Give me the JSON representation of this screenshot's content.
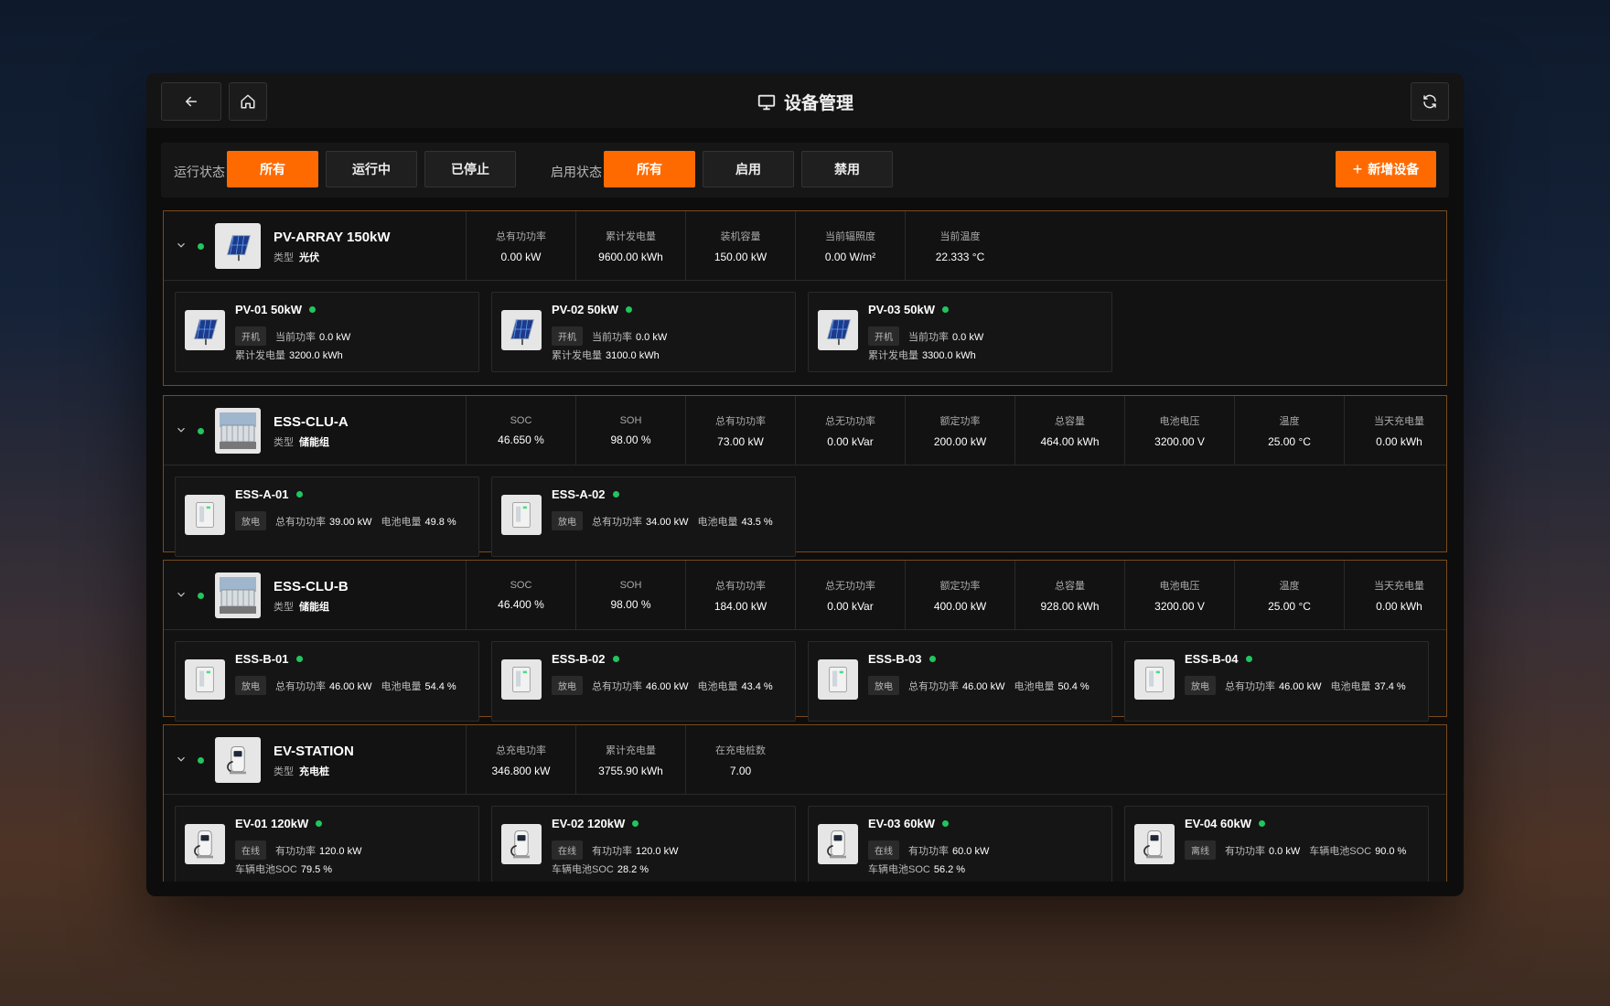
{
  "header": {
    "title": "设备管理"
  },
  "icons": {
    "back": "arrow-left-icon",
    "home": "home-icon",
    "title": "monitor-icon",
    "refresh": "refresh-icon",
    "add": "plus-icon",
    "expand": "chevron-down-icon"
  },
  "colors": {
    "accent": "#ff6a00",
    "online": "#22c55e",
    "group_border": "#7a4a1c"
  },
  "filters": {
    "run_label": "运行状态",
    "run_options": [
      "所有",
      "运行中",
      "已停止"
    ],
    "run_selected": "所有",
    "enable_label": "启用状态",
    "enable_options": [
      "所有",
      "启用",
      "禁用"
    ],
    "enable_selected": "所有",
    "add_label": "新增设备"
  },
  "groups": [
    {
      "name": "PV-ARRAY 150kW",
      "type_label": "类型",
      "type": "光伏",
      "thumb": "solar-panel",
      "metrics": [
        {
          "label": "总有功功率",
          "value": "0.00 kW"
        },
        {
          "label": "累计发电量",
          "value": "9600.00 kWh"
        },
        {
          "label": "装机容量",
          "value": "150.00 kW"
        },
        {
          "label": "当前辐照度",
          "value": "0.00 W/m²"
        },
        {
          "label": "当前温度",
          "value": "22.333 °C"
        }
      ],
      "devices": [
        {
          "name": "PV-01 50kW",
          "tag": "开机",
          "l1_label": "当前功率",
          "l1_value": "0.0 kW",
          "l2_label": "累计发电量",
          "l2_value": "3200.0 kWh"
        },
        {
          "name": "PV-02 50kW",
          "tag": "开机",
          "l1_label": "当前功率",
          "l1_value": "0.0 kW",
          "l2_label": "累计发电量",
          "l2_value": "3100.0 kWh"
        },
        {
          "name": "PV-03 50kW",
          "tag": "开机",
          "l1_label": "当前功率",
          "l1_value": "0.0 kW",
          "l2_label": "累计发电量",
          "l2_value": "3300.0 kWh"
        }
      ]
    },
    {
      "name": "ESS-CLU-A",
      "type_label": "类型",
      "type": "储能组",
      "thumb": "storage-cluster",
      "metrics": [
        {
          "label": "SOC",
          "value": "46.650 %"
        },
        {
          "label": "SOH",
          "value": "98.00 %"
        },
        {
          "label": "总有功功率",
          "value": "73.00 kW"
        },
        {
          "label": "总无功功率",
          "value": "0.00 kVar"
        },
        {
          "label": "额定功率",
          "value": "200.00 kW"
        },
        {
          "label": "总容量",
          "value": "464.00 kWh"
        },
        {
          "label": "电池电压",
          "value": "3200.00 V"
        },
        {
          "label": "温度",
          "value": "25.00 °C"
        },
        {
          "label": "当天充电量",
          "value": "0.00 kWh"
        }
      ],
      "devices": [
        {
          "name": "ESS-A-01",
          "tag": "放电",
          "l1_label": "总有功功率",
          "l1_value": "39.00 kW",
          "l1b_label": "电池电量",
          "l1b_value": "49.8 %"
        },
        {
          "name": "ESS-A-02",
          "tag": "放电",
          "l1_label": "总有功功率",
          "l1_value": "34.00 kW",
          "l1b_label": "电池电量",
          "l1b_value": "43.5 %"
        }
      ]
    },
    {
      "name": "ESS-CLU-B",
      "type_label": "类型",
      "type": "储能组",
      "thumb": "storage-cluster",
      "metrics": [
        {
          "label": "SOC",
          "value": "46.400 %"
        },
        {
          "label": "SOH",
          "value": "98.00 %"
        },
        {
          "label": "总有功功率",
          "value": "184.00 kW"
        },
        {
          "label": "总无功功率",
          "value": "0.00 kVar"
        },
        {
          "label": "额定功率",
          "value": "400.00 kW"
        },
        {
          "label": "总容量",
          "value": "928.00 kWh"
        },
        {
          "label": "电池电压",
          "value": "3200.00 V"
        },
        {
          "label": "温度",
          "value": "25.00 °C"
        },
        {
          "label": "当天充电量",
          "value": "0.00 kWh"
        }
      ],
      "devices": [
        {
          "name": "ESS-B-01",
          "tag": "放电",
          "l1_label": "总有功功率",
          "l1_value": "46.00 kW",
          "l1b_label": "电池电量",
          "l1b_value": "54.4 %"
        },
        {
          "name": "ESS-B-02",
          "tag": "放电",
          "l1_label": "总有功功率",
          "l1_value": "46.00 kW",
          "l1b_label": "电池电量",
          "l1b_value": "43.4 %"
        },
        {
          "name": "ESS-B-03",
          "tag": "放电",
          "l1_label": "总有功功率",
          "l1_value": "46.00 kW",
          "l1b_label": "电池电量",
          "l1b_value": "50.4 %"
        },
        {
          "name": "ESS-B-04",
          "tag": "放电",
          "l1_label": "总有功功率",
          "l1_value": "46.00 kW",
          "l1b_label": "电池电量",
          "l1b_value": "37.4 %"
        }
      ]
    },
    {
      "name": "EV-STATION",
      "type_label": "类型",
      "type": "充电桩",
      "thumb": "charger",
      "metrics": [
        {
          "label": "总充电功率",
          "value": "346.800 kW"
        },
        {
          "label": "累计充电量",
          "value": "3755.90 kWh"
        },
        {
          "label": "在充电桩数",
          "value": "7.00"
        }
      ],
      "devices": [
        {
          "name": "EV-01 120kW",
          "tag": "在线",
          "l1_label": "有功功率",
          "l1_value": "120.0 kW",
          "l2_label": "车辆电池SOC",
          "l2_value": "79.5 %"
        },
        {
          "name": "EV-02 120kW",
          "tag": "在线",
          "l1_label": "有功功率",
          "l1_value": "120.0 kW",
          "l2_label": "车辆电池SOC",
          "l2_value": "28.2 %"
        },
        {
          "name": "EV-03 60kW",
          "tag": "在线",
          "l1_label": "有功功率",
          "l1_value": "60.0 kW",
          "l2_label": "车辆电池SOC",
          "l2_value": "56.2 %"
        },
        {
          "name": "EV-04 60kW",
          "tag": "离线",
          "l1_label": "有功功率",
          "l1_value": "0.0 kW",
          "l1b_label": "车辆电池SOC",
          "l1b_value": "90.0 %"
        }
      ]
    }
  ]
}
